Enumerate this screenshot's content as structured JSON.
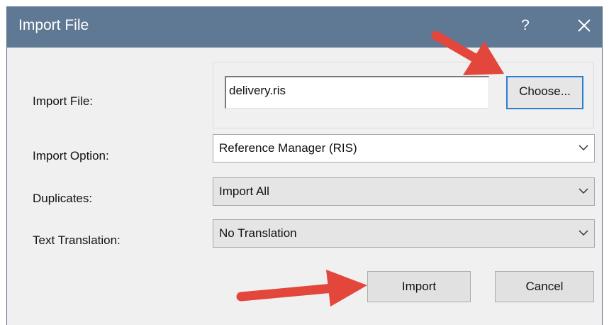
{
  "window": {
    "title": "Import File",
    "help_label": "?",
    "close_icon": "close-icon"
  },
  "form": {
    "import_file_label": "Import File:",
    "import_file_value": "delivery.ris",
    "choose_label": "Choose...",
    "import_option_label": "Import Option:",
    "import_option_value": "Reference Manager (RIS)",
    "duplicates_label": "Duplicates:",
    "duplicates_value": "Import All",
    "text_translation_label": "Text Translation:",
    "text_translation_value": "No Translation"
  },
  "buttons": {
    "import_label": "Import",
    "cancel_label": "Cancel"
  },
  "colors": {
    "titlebar": "#5f7894",
    "focus_border": "#2a7fd4",
    "annotation_arrow": "#e3463b"
  }
}
